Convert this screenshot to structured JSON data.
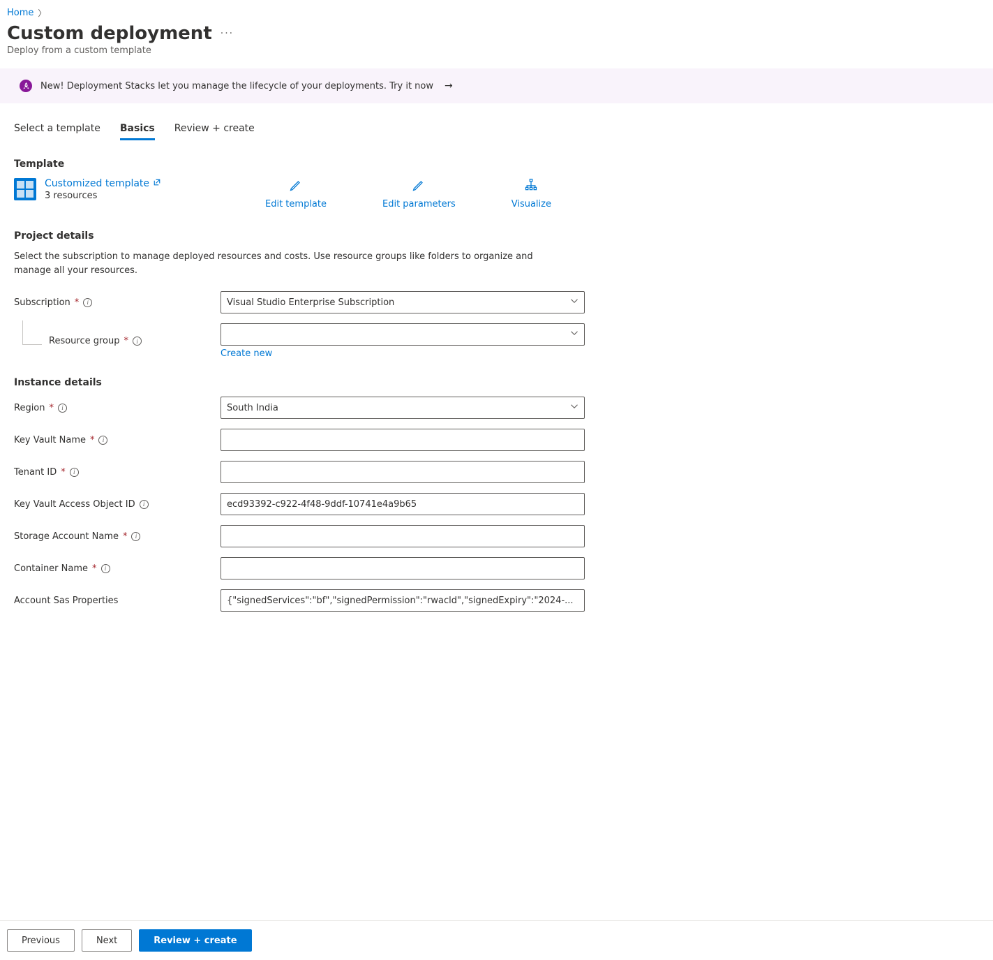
{
  "breadcrumb": {
    "home": "Home"
  },
  "page": {
    "title": "Custom deployment",
    "subtitle": "Deploy from a custom template"
  },
  "banner": {
    "text": "New! Deployment Stacks let you manage the lifecycle of your deployments. Try it now"
  },
  "tabs": {
    "select_template": "Select a template",
    "basics": "Basics",
    "review_create": "Review + create"
  },
  "template": {
    "heading": "Template",
    "link_label": "Customized template",
    "resources_text": "3 resources",
    "actions": {
      "edit_template": "Edit template",
      "edit_parameters": "Edit parameters",
      "visualize": "Visualize"
    }
  },
  "project_details": {
    "heading": "Project details",
    "help": "Select the subscription to manage deployed resources and costs. Use resource groups like folders to organize and manage all your resources.",
    "subscription_label": "Subscription",
    "subscription_value": "Visual Studio Enterprise Subscription",
    "resource_group_label": "Resource group",
    "resource_group_value": "",
    "create_new": "Create new"
  },
  "instance_details": {
    "heading": "Instance details",
    "region_label": "Region",
    "region_value": "South India",
    "key_vault_name_label": "Key Vault Name",
    "key_vault_name_value": "",
    "tenant_id_label": "Tenant ID",
    "tenant_id_value": "",
    "kv_access_object_id_label": "Key Vault Access Object ID",
    "kv_access_object_id_value": "ecd93392-c922-4f48-9ddf-10741e4a9b65",
    "storage_account_name_label": "Storage Account Name",
    "storage_account_name_value": "",
    "container_name_label": "Container Name",
    "container_name_value": "",
    "account_sas_label": "Account Sas Properties",
    "account_sas_value": "{\"signedServices\":\"bf\",\"signedPermission\":\"rwacld\",\"signedExpiry\":\"2024-..."
  },
  "footer": {
    "previous": "Previous",
    "next": "Next",
    "review_create": "Review + create"
  }
}
